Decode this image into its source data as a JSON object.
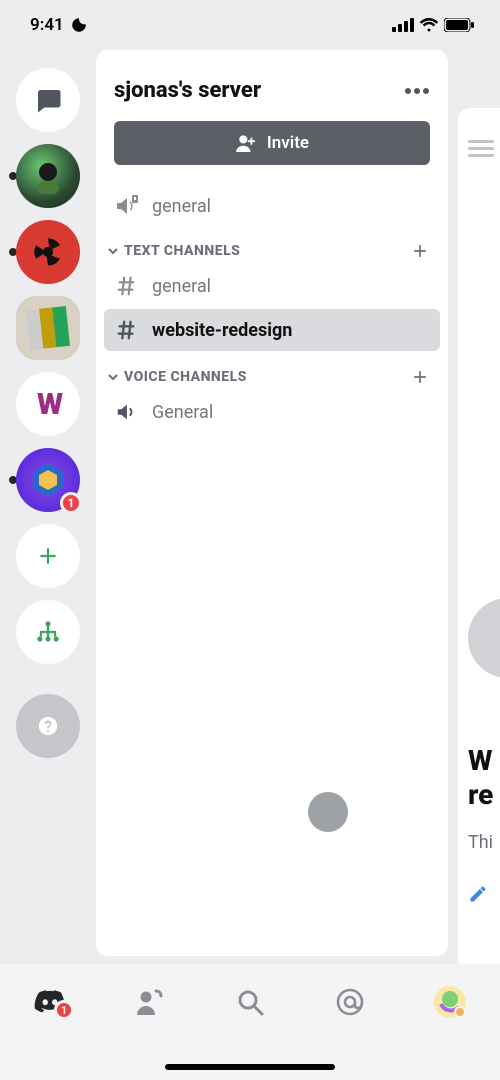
{
  "status": {
    "time": "9:41"
  },
  "server": {
    "title": "sjonas's server",
    "invite_label": "Invite"
  },
  "rules_channel": {
    "name": "general"
  },
  "sections": {
    "text": {
      "title": "TEXT CHANNELS"
    },
    "voice": {
      "title": "VOICE CHANNELS"
    }
  },
  "text_channels": [
    {
      "name": "general",
      "selected": false
    },
    {
      "name": "website-redesign",
      "selected": true
    }
  ],
  "voice_channels": [
    {
      "name": "General"
    }
  ],
  "server_rail": {
    "notification_badge": "1"
  },
  "peek": {
    "heading_line1": "W",
    "heading_line2": "re",
    "sub": "Thi"
  },
  "bottom_nav": {
    "home_badge": "1"
  }
}
